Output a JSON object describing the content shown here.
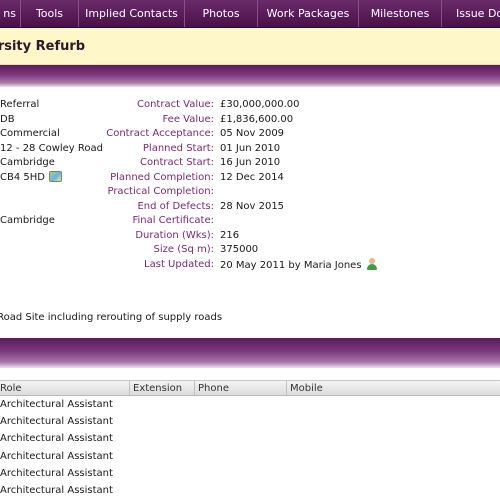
{
  "nav": {
    "tabs": [
      "ns",
      "Tools",
      "Implied Contacts",
      "Photos",
      "Work Packages",
      "Milestones",
      "Issue Doc"
    ]
  },
  "header": {
    "title": "ersity Refurb"
  },
  "left_details": [
    "Referral",
    "DB",
    "Commercial",
    "12 - 28 Cowley Road",
    "Cambridge",
    "CB4 5HD",
    "",
    "",
    "Cambridge"
  ],
  "fields": [
    {
      "label": "Contract Value:",
      "value": "£30,000,000.00"
    },
    {
      "label": "Fee Value:",
      "value": "£1,836,600.00"
    },
    {
      "label": "Contract Acceptance:",
      "value": "05 Nov 2009"
    },
    {
      "label": "Planned Start:",
      "value": "01 Jun 2010"
    },
    {
      "label": "Contract Start:",
      "value": "16 Jun 2010"
    },
    {
      "label": "Planned Completion:",
      "value": "12 Dec 2014"
    },
    {
      "label": "Practical Completion:",
      "value": ""
    },
    {
      "label": "End of Defects:",
      "value": "28 Nov 2015"
    },
    {
      "label": "Final Certificate:",
      "value": ""
    },
    {
      "label": "Duration (Wks):",
      "value": "216"
    },
    {
      "label": "Size (Sq m):",
      "value": "375000"
    },
    {
      "label": "Last Updated:",
      "value": "20 May 2011 by Maria Jones"
    }
  ],
  "description": "y Road Site including rerouting of supply roads",
  "contacts": {
    "columns": [
      "Role",
      "Extension",
      "Phone",
      "Mobile"
    ],
    "rows": [
      "Architectural Assistant",
      "Architectural Assistant",
      "Architectural Assistant",
      "Architectural Assistant",
      "Architectural Assistant",
      "Architectural Assistant"
    ]
  },
  "icons": {
    "map": "map-icon",
    "user": "user-icon"
  },
  "colors": {
    "nav_bg": "#5a1a59",
    "title_bg": "#fdf7c9",
    "label": "#7a2a74"
  }
}
